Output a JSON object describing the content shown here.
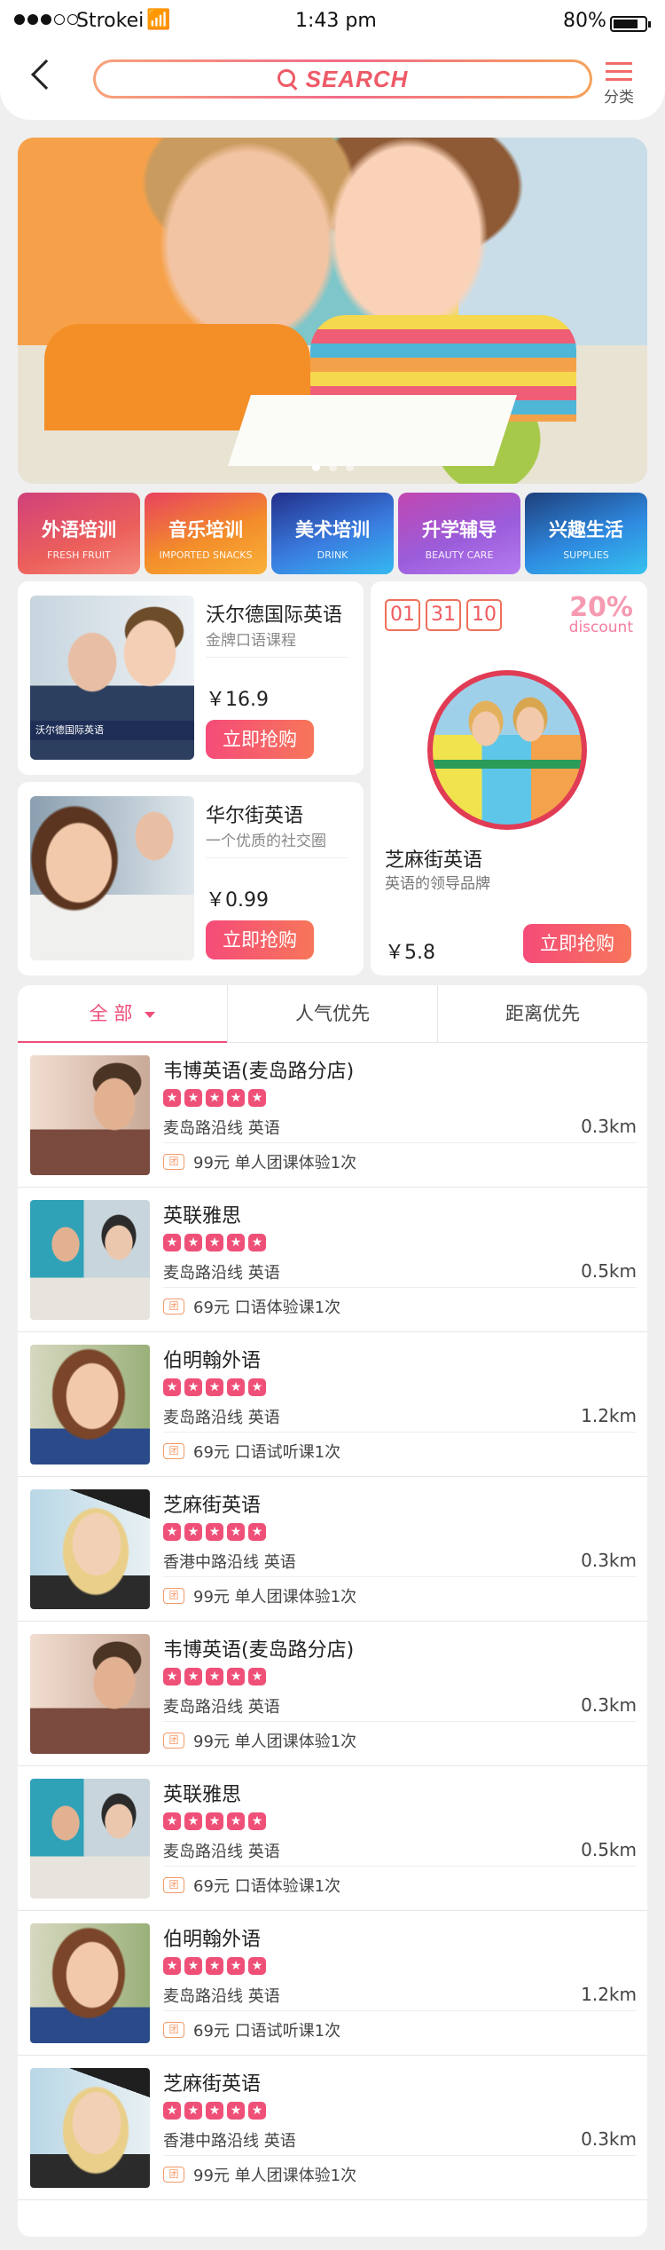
{
  "status": {
    "carrier": "Strokei",
    "time": "1:43 pm",
    "battery": "80%",
    "battery_level": 0.8
  },
  "header": {
    "search_placeholder": "SEARCH",
    "menu_label": "分类"
  },
  "banner": {
    "slides": 3,
    "active_slide": 1
  },
  "categories": [
    {
      "title": "外语培训",
      "subtitle": "FRESH FRUIT"
    },
    {
      "title": "音乐培训",
      "subtitle": "IMPORTED SNACKS"
    },
    {
      "title": "美术培训",
      "subtitle": "DRINK"
    },
    {
      "title": "升学辅导",
      "subtitle": "BEAUTY CARE"
    },
    {
      "title": "兴趣生活",
      "subtitle": "SUPPLIES"
    }
  ],
  "promos": [
    {
      "title": "沃尔德国际英语",
      "subtitle": "金牌口语课程",
      "price": "￥16.9",
      "button": "立即抢购",
      "logo_text": "沃尔德国际英语"
    },
    {
      "title": "华尔街英语",
      "subtitle": "一个优质的社交圈",
      "price": "￥0.99",
      "button": "立即抢购"
    }
  ],
  "featured": {
    "countdown": [
      "01",
      "31",
      "10"
    ],
    "discount_pct": "20%",
    "discount_word": "discount",
    "title": "芝麻街英语",
    "subtitle": "英语的领导品牌",
    "price": "￥5.8",
    "button": "立即抢购"
  },
  "tabs": [
    {
      "label": "全 部"
    },
    {
      "label": "人气优先"
    },
    {
      "label": "距离优先"
    }
  ],
  "listings": [
    {
      "name": "韦博英语(麦岛路分店)",
      "rating": 5,
      "location": "麦岛路沿线  英语",
      "distance": "0.3km",
      "deal_badge": "团",
      "deal": "99元 单人团课体验1次"
    },
    {
      "name": "英联雅思",
      "rating": 5,
      "location": "麦岛路沿线  英语",
      "distance": "0.5km",
      "deal_badge": "团",
      "deal": "69元 口语体验课1次"
    },
    {
      "name": "伯明翰外语",
      "rating": 5,
      "location": "麦岛路沿线  英语",
      "distance": "1.2km",
      "deal_badge": "团",
      "deal": "69元 口语试听课1次"
    },
    {
      "name": "芝麻街英语",
      "rating": 5,
      "location": "香港中路沿线 英语",
      "distance": "0.3km",
      "deal_badge": "团",
      "deal": "99元 单人团课体验1次"
    },
    {
      "name": "韦博英语(麦岛路分店)",
      "rating": 5,
      "location": "麦岛路沿线  英语",
      "distance": "0.3km",
      "deal_badge": "团",
      "deal": "99元 单人团课体验1次"
    },
    {
      "name": "英联雅思",
      "rating": 5,
      "location": "麦岛路沿线  英语",
      "distance": "0.5km",
      "deal_badge": "团",
      "deal": "69元 口语体验课1次"
    },
    {
      "name": "伯明翰外语",
      "rating": 5,
      "location": "麦岛路沿线  英语",
      "distance": "1.2km",
      "deal_badge": "团",
      "deal": "69元 口语试听课1次"
    },
    {
      "name": "芝麻街英语",
      "rating": 5,
      "location": "香港中路沿线 英语",
      "distance": "0.3km",
      "deal_badge": "团",
      "deal": "99元 单人团课体验1次"
    }
  ],
  "colors": {
    "accent": "#ef4f7a",
    "button_start": "#f54b79",
    "button_end": "#f7765a",
    "countdown": "#ef6f5a"
  }
}
